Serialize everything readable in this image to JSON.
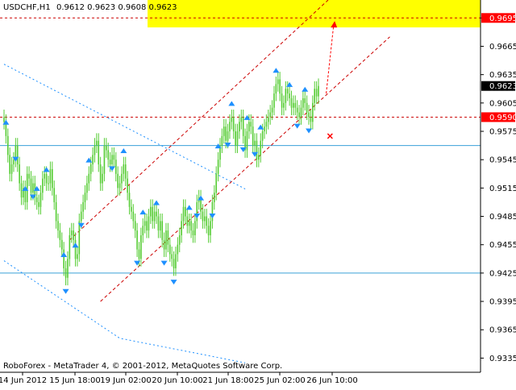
{
  "header": {
    "symbol": "USDCHF,H1",
    "ohlc": "0.9612 0.9623 0.9608 0.9623"
  },
  "footer": {
    "copyright": "RoboForex - MetaTrader 4, © 2001-2012, MetaQuotes Software Corp."
  },
  "chart_data": {
    "type": "line",
    "symbol": "USDCHF",
    "timeframe": "H1",
    "title": "USDCHF,H1",
    "ylim": [
      0.932,
      0.9714
    ],
    "y_ticks": [
      "0.9695",
      "0.9665",
      "0.9635",
      "0.9605",
      "0.9575",
      "0.9545",
      "0.9515",
      "0.9485",
      "0.9455",
      "0.9425",
      "0.9395",
      "0.9365",
      "0.9335"
    ],
    "y_tick_values": [
      0.9695,
      0.9665,
      0.9635,
      0.9605,
      0.9575,
      0.9545,
      0.9515,
      0.9485,
      0.9455,
      0.9425,
      0.9395,
      0.9365,
      0.9335
    ],
    "x_ticks": [
      "14 Jun 2012",
      "15 Jun 18:00",
      "19 Jun 02:00",
      "20 Jun 10:00",
      "21 Jun 18:00",
      "25 Jun 02:00",
      "26 Jun 10:00"
    ],
    "price_labels": [
      {
        "value": 0.9695,
        "text": "0.9695",
        "color": "#ff0000"
      },
      {
        "value": 0.9623,
        "text": "0.9623",
        "color": "#000000"
      },
      {
        "value": 0.959,
        "text": "0.9590",
        "color": "#ff0000"
      }
    ],
    "horizontal_levels": [
      {
        "value": 0.9695,
        "style": "dashed",
        "color": "#cc0000"
      },
      {
        "value": 0.959,
        "style": "dashed",
        "color": "#cc0000"
      },
      {
        "value": 0.956,
        "style": "solid",
        "color": "#3aa0d8"
      },
      {
        "value": 0.9425,
        "style": "solid",
        "color": "#3aa0d8"
      }
    ],
    "target_zone": {
      "from": 0.9685,
      "to": 0.9714,
      "color": "#ffff00"
    },
    "series": [
      {
        "values": [
          0.9585,
          0.957,
          0.955,
          0.953,
          0.954,
          0.9545,
          0.956,
          0.954,
          0.952,
          0.9505,
          0.9515,
          0.95,
          0.953,
          0.9525,
          0.951,
          0.952,
          0.9505,
          0.95,
          0.9495,
          0.951,
          0.9525,
          0.953,
          0.952,
          0.952,
          0.9535,
          0.9515,
          0.95,
          0.948,
          0.947,
          0.946,
          0.945,
          0.943,
          0.942,
          0.944,
          0.9465,
          0.947,
          0.946,
          0.944,
          0.9445,
          0.948,
          0.949,
          0.95,
          0.951,
          0.952,
          0.953,
          0.954,
          0.955,
          0.956,
          0.9565,
          0.954,
          0.952,
          0.953,
          0.956,
          0.9555,
          0.9545,
          0.954,
          0.955,
          0.9545,
          0.953,
          0.9515,
          0.952,
          0.953,
          0.954,
          0.9525,
          0.951,
          0.9495,
          0.949,
          0.948,
          0.947,
          0.945,
          0.944,
          0.9465,
          0.9475,
          0.948,
          0.947,
          0.9485,
          0.9495,
          0.948,
          0.949,
          0.9485,
          0.947,
          0.948,
          0.946,
          0.945,
          0.947,
          0.9455,
          0.9445,
          0.944,
          0.943,
          0.9445,
          0.9455,
          0.9465,
          0.948,
          0.9495,
          0.9485,
          0.9475,
          0.948,
          0.947,
          0.9465,
          0.948,
          0.95,
          0.9505,
          0.949,
          0.948,
          0.9485,
          0.9475,
          0.9465,
          0.948,
          0.95,
          0.951,
          0.953,
          0.9545,
          0.956,
          0.957,
          0.958,
          0.9565,
          0.9575,
          0.9585,
          0.959,
          0.9575,
          0.956,
          0.9575,
          0.9585,
          0.959,
          0.957,
          0.9555,
          0.9575,
          0.9585,
          0.958,
          0.956,
          0.9565,
          0.9545,
          0.955,
          0.9565,
          0.9575,
          0.958,
          0.9585,
          0.959,
          0.9595,
          0.96,
          0.9615,
          0.9625,
          0.963,
          0.9615,
          0.96,
          0.9605,
          0.962,
          0.9615,
          0.961,
          0.96,
          0.9605,
          0.96,
          0.9595,
          0.959,
          0.96,
          0.961,
          0.9605,
          0.9595,
          0.959,
          0.9585,
          0.9605,
          0.962,
          0.9612,
          0.9623
        ]
      }
    ],
    "channel_lines": [
      {
        "points": [
          [
            0,
            0.9646
          ],
          [
            125,
            0.9514
          ]
        ],
        "style": "dotted",
        "color": "#1e90ff"
      },
      {
        "points": [
          [
            0,
            0.9438
          ],
          [
            60,
            0.9356
          ],
          [
            125,
            0.933
          ]
        ],
        "style": "dotted",
        "color": "#1e90ff"
      },
      {
        "points": [
          [
            34,
            0.946
          ],
          [
            168,
            0.9714
          ]
        ],
        "style": "dashed",
        "color": "#cc0000"
      },
      {
        "points": [
          [
            50,
            0.9395
          ],
          [
            200,
            0.9675
          ]
        ],
        "style": "dashed",
        "color": "#cc0000"
      }
    ],
    "forecast_arrow": {
      "from": [
        167,
        0.9615
      ],
      "to": [
        171,
        0.969
      ],
      "color": "#ff0000"
    },
    "cross_marker": {
      "at": [
        169,
        0.957
      ],
      "color": "#ff0000"
    },
    "fractals_up": [
      1,
      11,
      17,
      22,
      31,
      37,
      44,
      62,
      72,
      79,
      96,
      102,
      111,
      118,
      126,
      133,
      141,
      148,
      156
    ],
    "fractals_down": [
      6,
      15,
      32,
      40,
      56,
      69,
      83,
      88,
      100,
      108,
      116,
      124,
      130,
      152,
      158
    ],
    "colors": {
      "background": "#ffffff",
      "candle": "#55cc33",
      "axis": "#000000",
      "text": "#000000",
      "fractal": "#1e90ff",
      "level": "#3aa0d8",
      "target": "#ffff00",
      "forecast": "#ff0000"
    }
  }
}
